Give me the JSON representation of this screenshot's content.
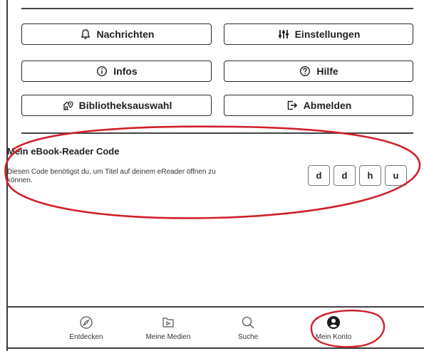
{
  "menu": {
    "messages": {
      "label": "Nachrichten",
      "icon": "bell-icon"
    },
    "settings": {
      "label": "Einstellungen",
      "icon": "sliders-icon"
    },
    "info": {
      "label": "Infos",
      "icon": "info-icon"
    },
    "help": {
      "label": "Hilfe",
      "icon": "question-icon"
    },
    "library": {
      "label": "Bibliotheksauswahl",
      "icon": "library-location-icon"
    },
    "logout": {
      "label": "Abmelden",
      "icon": "logout-icon"
    }
  },
  "ereader_code": {
    "title": "Mein eBook-Reader Code",
    "description": "Diesen Code benötigst du, um Titel auf deinem eReader öffnen zu können.",
    "chars": [
      "d",
      "d",
      "h",
      "u"
    ]
  },
  "bottom_nav": {
    "items": [
      {
        "label": "Entdecken",
        "icon": "compass-icon"
      },
      {
        "label": "Meine Medien",
        "icon": "media-icon"
      },
      {
        "label": "Suche",
        "icon": "search-icon"
      },
      {
        "label": "Mein Konto",
        "icon": "account-icon",
        "active": true
      }
    ]
  },
  "colors": {
    "annotation": "#d0202a",
    "text": "#222222",
    "border": "#2a2a2a"
  }
}
